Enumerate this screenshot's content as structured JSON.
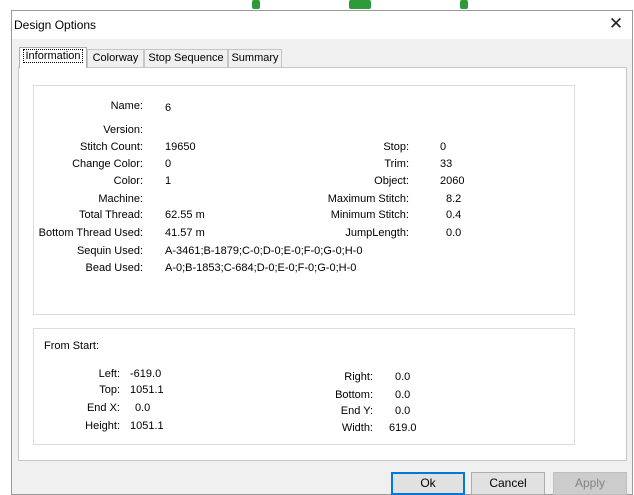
{
  "window": {
    "title": "Design Options"
  },
  "tabs": [
    "Information",
    "Colorway",
    "Stop Sequence",
    "Summary"
  ],
  "info": {
    "name": {
      "label": "Name:",
      "value": "6"
    },
    "version": {
      "label": "Version:",
      "value": ""
    },
    "stitch_count": {
      "label": "Stitch Count:",
      "value": "19650"
    },
    "change_color": {
      "label": "Change Color:",
      "value": "0"
    },
    "color": {
      "label": "Color:",
      "value": "1"
    },
    "machine": {
      "label": "Machine:",
      "value": ""
    },
    "total_thread": {
      "label": "Total Thread:",
      "value": "62.55 m"
    },
    "bottom_thread": {
      "label": "Bottom Thread Used:",
      "value": "41.57 m"
    },
    "sequin_used": {
      "label": "Sequin Used:",
      "value": "A-3461;B-1879;C-0;D-0;E-0;F-0;G-0;H-0"
    },
    "bead_used": {
      "label": "Bead Used:",
      "value": "A-0;B-1853;C-684;D-0;E-0;F-0;G-0;H-0"
    },
    "stop": {
      "label": "Stop:",
      "value": "0"
    },
    "trim": {
      "label": "Trim:",
      "value": "33"
    },
    "object": {
      "label": "Object:",
      "value": "2060"
    },
    "max_stitch": {
      "label": "Maximum Stitch:",
      "value": "8.2"
    },
    "min_stitch": {
      "label": "Minimum Stitch:",
      "value": "0.4"
    },
    "jump_length": {
      "label": "JumpLength:",
      "value": "0.0"
    }
  },
  "from_start": {
    "heading": "From Start:",
    "left": {
      "label": "Left:",
      "value": "-619.0"
    },
    "top": {
      "label": "Top:",
      "value": "1051.1"
    },
    "end_x": {
      "label": "End X:",
      "value": "0.0"
    },
    "height": {
      "label": "Height:",
      "value": "1051.1"
    },
    "right": {
      "label": "Right:",
      "value": "0.0"
    },
    "bottom": {
      "label": "Bottom:",
      "value": "0.0"
    },
    "end_y": {
      "label": "End Y:",
      "value": "0.0"
    },
    "width": {
      "label": "Width:",
      "value": "619.0"
    }
  },
  "buttons": {
    "ok": "Ok",
    "cancel": "Cancel",
    "apply": "Apply"
  },
  "colors": {
    "accent": "#0078d7",
    "speck": "#2f9a3a"
  }
}
